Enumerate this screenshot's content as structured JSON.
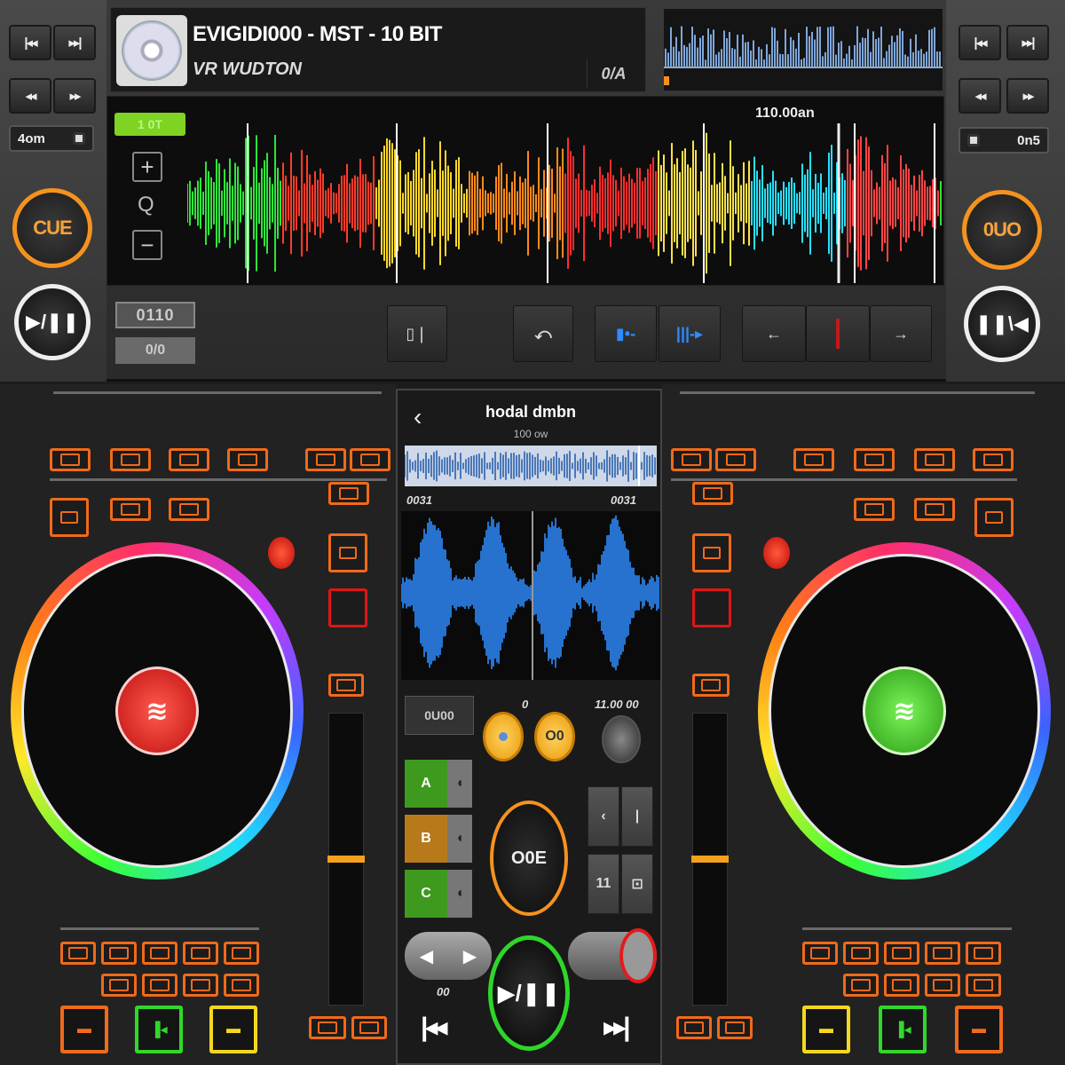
{
  "left_deck": {
    "top_buttons": [
      "|◂◂",
      "▸▸|"
    ],
    "nav_buttons": [
      "◂◂",
      "▸▸"
    ],
    "pitch_label": "4om",
    "cue_label": "CUE",
    "play_label": "▶/❚❚",
    "mode_chip_top": "0110",
    "mode_chip_bottom": "0/0",
    "hub_color": "#e0241e"
  },
  "right_deck": {
    "top_buttons": [
      "|◂◂",
      "▸▸|"
    ],
    "nav_buttons": [
      "◂◂",
      "▸▸"
    ],
    "pitch_label": "0n5",
    "cue_label": "0UO",
    "play_label": "❚❚\\◀",
    "hub_color": "#4fd92a"
  },
  "track": {
    "title": "EVIGIDI000 - MST - 10 BIT",
    "artist": "VR WUDTON",
    "key": "0/A"
  },
  "waveform": {
    "bpm_chip": "1 0T",
    "time_label": "110.00an",
    "zoom_in": "+",
    "zoom_search": "Q",
    "zoom_out": "−"
  },
  "toolbar": {
    "loop_icon": "▯❘",
    "curve_icon": "⤺",
    "blue_a": "▮•-",
    "blue_b": "|||-▸",
    "arrow_left": "←",
    "arrow_right": "→"
  },
  "mixer": {
    "back": "‹",
    "title": "hodal dmbn",
    "subtitle": "100 ow",
    "time_left": "0031",
    "time_right": "0031",
    "btn_left": "0U00",
    "meter_label": "11.00 00",
    "eq_label": "0",
    "knob_b": "O0",
    "big_cue": "O0E",
    "hotcues": [
      {
        "label": "A",
        "color": "#3e9a1e"
      },
      {
        "label": "B",
        "color": "#b77a1b"
      },
      {
        "label": "C",
        "color": "#3e9a1e"
      }
    ],
    "pads": [
      "‹",
      "|",
      "11",
      "⊡"
    ],
    "play": "▶/❚❚",
    "prev": "|◂◂",
    "next": "▸▸|",
    "small_label": "00"
  },
  "colors": {
    "accent_orange": "#f06a1a",
    "cue_orange": "#f5921e",
    "wave_blue": "#2d8cff",
    "green_play": "#2ed62a"
  }
}
